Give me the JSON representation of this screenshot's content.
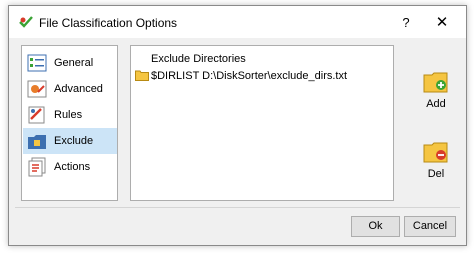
{
  "window": {
    "title": "File Classification Options",
    "help_label": "?",
    "close_label": "✕"
  },
  "sidebar": {
    "items": [
      {
        "label": "General",
        "icon": "general-icon"
      },
      {
        "label": "Advanced",
        "icon": "advanced-icon"
      },
      {
        "label": "Rules",
        "icon": "rules-icon"
      },
      {
        "label": "Exclude",
        "icon": "exclude-icon",
        "selected": true
      },
      {
        "label": "Actions",
        "icon": "actions-icon"
      }
    ]
  },
  "panel": {
    "header": "Exclude Directories",
    "rows": [
      {
        "text": "$DIRLIST D:\\DiskSorter\\exclude_dirs.txt",
        "icon": "folder-icon"
      }
    ]
  },
  "actions": {
    "add_label": "Add",
    "del_label": "Del"
  },
  "footer": {
    "ok_label": "Ok",
    "cancel_label": "Cancel"
  },
  "colors": {
    "selection": "#cce4f7",
    "folder": "#f5c542",
    "add_badge": "#3aa335",
    "del_badge": "#d83b2b"
  }
}
